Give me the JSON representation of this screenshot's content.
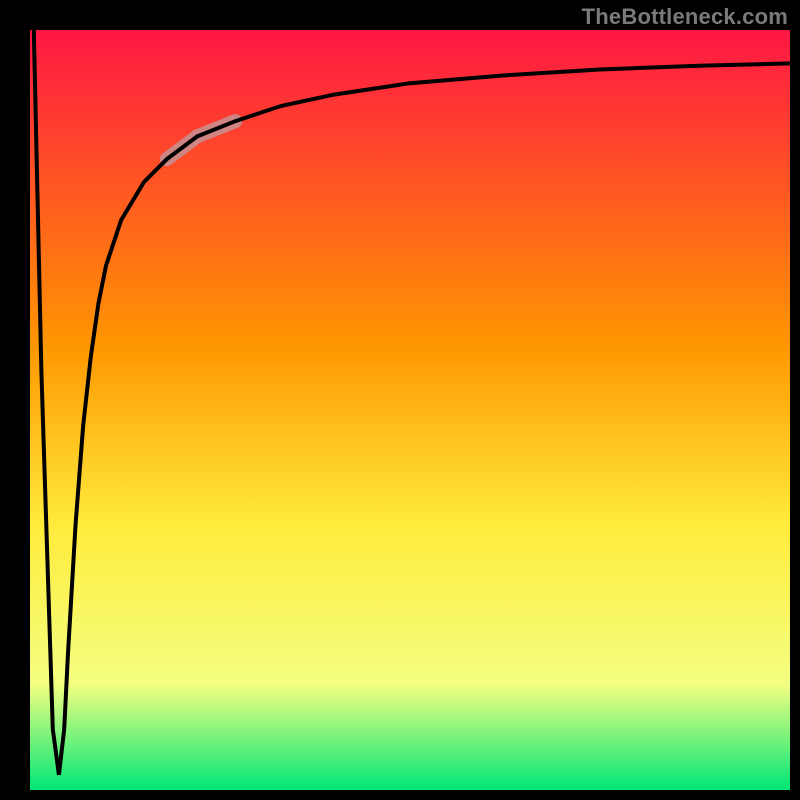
{
  "watermark": "TheBottleneck.com",
  "colors": {
    "bg": "#000000",
    "grad_top": "#ff1744",
    "grad_mid1": "#ff9800",
    "grad_mid2": "#ffeb3b",
    "grad_mid3": "#f4ff81",
    "grad_bottom": "#00e676",
    "curve": "#000000",
    "highlight": "#c98d8d",
    "watermark": "#7a7a7a"
  },
  "chart_data": {
    "type": "line",
    "title": "",
    "xlabel": "",
    "ylabel": "",
    "xlim": [
      0,
      100
    ],
    "ylim": [
      0,
      100
    ],
    "grid": false,
    "legend": false,
    "series": [
      {
        "name": "bottleneck-curve",
        "x": [
          0.5,
          1.5,
          3.0,
          3.8,
          4.5,
          5.0,
          6.0,
          7.0,
          8.0,
          9.0,
          10.0,
          12.0,
          15.0,
          18.0,
          22.0,
          27.0,
          33.0,
          40.0,
          50.0,
          62.0,
          75.0,
          88.0,
          100.0
        ],
        "y": [
          100,
          55,
          8,
          2,
          8,
          18,
          35,
          48,
          57,
          64,
          69,
          75,
          80,
          83,
          86,
          88,
          90,
          91.5,
          93,
          94,
          94.8,
          95.3,
          95.6
        ]
      }
    ],
    "highlight_segment": {
      "series": "bottleneck-curve",
      "x_start": 18.0,
      "x_end": 27.0
    },
    "background_gradient": {
      "direction": "vertical",
      "stops": [
        {
          "pos": 0.0,
          "value": "worst"
        },
        {
          "pos": 0.45,
          "value": "mid-high"
        },
        {
          "pos": 0.7,
          "value": "mid"
        },
        {
          "pos": 0.88,
          "value": "mid-low"
        },
        {
          "pos": 1.0,
          "value": "best"
        }
      ]
    }
  }
}
